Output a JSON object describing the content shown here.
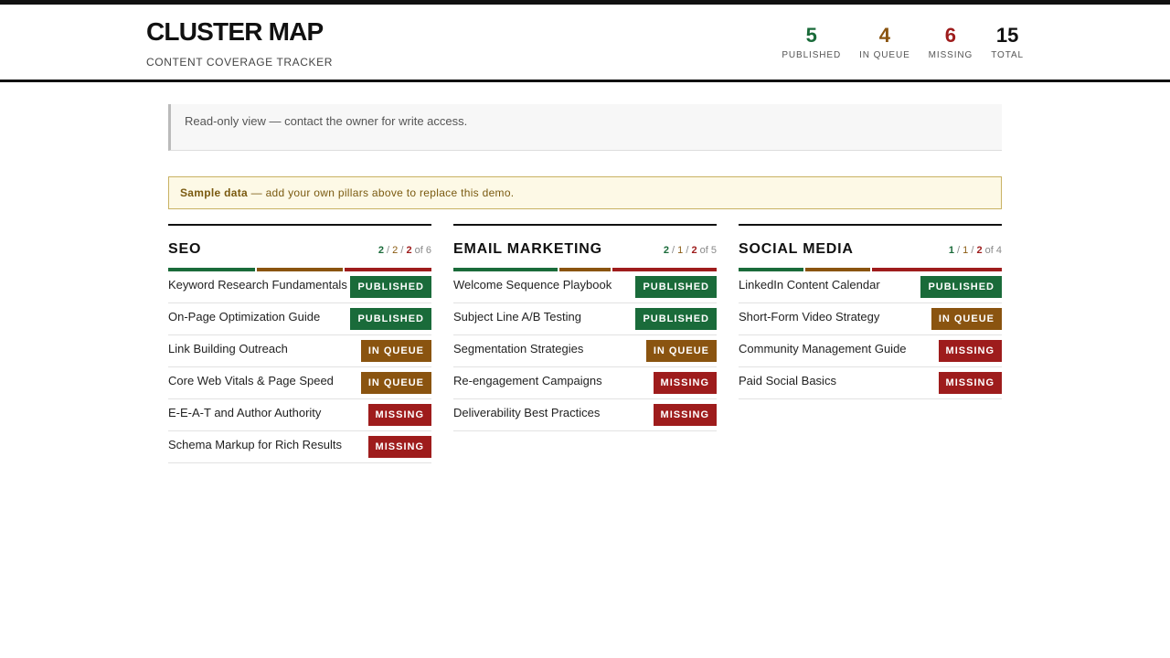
{
  "header": {
    "title": "CLUSTER MAP",
    "subtitle": "CONTENT COVERAGE TRACKER",
    "stats": [
      {
        "value": "5",
        "label": "PUBLISHED",
        "color": "#1a6b3a"
      },
      {
        "value": "4",
        "label": "IN QUEUE",
        "color": "#8a5410"
      },
      {
        "value": "6",
        "label": "MISSING",
        "color": "#9e1c1c"
      },
      {
        "value": "15",
        "label": "TOTAL",
        "color": "#111111"
      }
    ]
  },
  "notice": {
    "text": "Read-only view — contact the owner for write access."
  },
  "sample": {
    "bold": "Sample data",
    "rest": " — add your own pillars above to replace this demo."
  },
  "colors": {
    "published": "#1a6b3a",
    "queue": "#8a5410",
    "missing": "#9e1c1c"
  },
  "pillars": [
    {
      "title": "SEO",
      "published": "2",
      "queue": "2",
      "missing": "2",
      "total_text": "of 6",
      "items": [
        {
          "title": "Keyword Research Fundamentals",
          "status": "PUBLISHED"
        },
        {
          "title": "On-Page Optimization Guide",
          "status": "PUBLISHED"
        },
        {
          "title": "Link Building Outreach",
          "status": "IN QUEUE"
        },
        {
          "title": "Core Web Vitals & Page Speed",
          "status": "IN QUEUE"
        },
        {
          "title": "E-E-A-T and Author Authority",
          "status": "MISSING"
        },
        {
          "title": "Schema Markup for Rich Results",
          "status": "MISSING"
        }
      ]
    },
    {
      "title": "EMAIL MARKETING",
      "published": "2",
      "queue": "1",
      "missing": "2",
      "total_text": "of 5",
      "items": [
        {
          "title": "Welcome Sequence Playbook",
          "status": "PUBLISHED"
        },
        {
          "title": "Subject Line A/B Testing",
          "status": "PUBLISHED"
        },
        {
          "title": "Segmentation Strategies",
          "status": "IN QUEUE"
        },
        {
          "title": "Re-engagement Campaigns",
          "status": "MISSING"
        },
        {
          "title": "Deliverability Best Practices",
          "status": "MISSING"
        }
      ]
    },
    {
      "title": "SOCIAL MEDIA",
      "published": "1",
      "queue": "1",
      "missing": "2",
      "total_text": "of 4",
      "items": [
        {
          "title": "LinkedIn Content Calendar",
          "status": "PUBLISHED"
        },
        {
          "title": "Short-Form Video Strategy",
          "status": "IN QUEUE"
        },
        {
          "title": "Community Management Guide",
          "status": "MISSING"
        },
        {
          "title": "Paid Social Basics",
          "status": "MISSING"
        }
      ]
    }
  ]
}
